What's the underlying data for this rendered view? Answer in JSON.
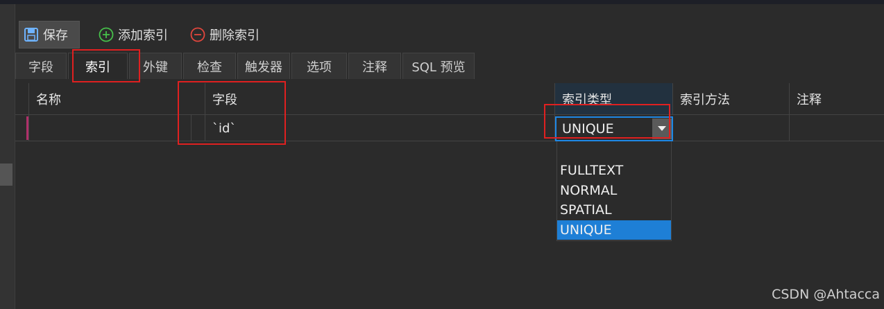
{
  "toolbar": {
    "save_label": "保存",
    "add_index_label": "添加索引",
    "delete_index_label": "删除索引"
  },
  "tabs": [
    {
      "label": "字段"
    },
    {
      "label": "索引"
    },
    {
      "label": "外键"
    },
    {
      "label": "检查"
    },
    {
      "label": "触发器"
    },
    {
      "label": "选项"
    },
    {
      "label": "注释"
    },
    {
      "label": "SQL 预览"
    }
  ],
  "grid": {
    "headers": [
      "名称",
      "字段",
      "索引类型",
      "索引方法",
      "注释"
    ],
    "row": {
      "name": "",
      "field": "`id`",
      "index_type": "UNIQUE",
      "index_method": "",
      "comment": ""
    }
  },
  "dropdown": {
    "options": [
      "",
      "FULLTEXT",
      "NORMAL",
      "SPATIAL",
      "UNIQUE"
    ],
    "selected": "UNIQUE"
  },
  "colors": {
    "accent": "#1e7fd6",
    "highlight": "#e02020"
  },
  "watermark": "CSDN @Ahtacca"
}
